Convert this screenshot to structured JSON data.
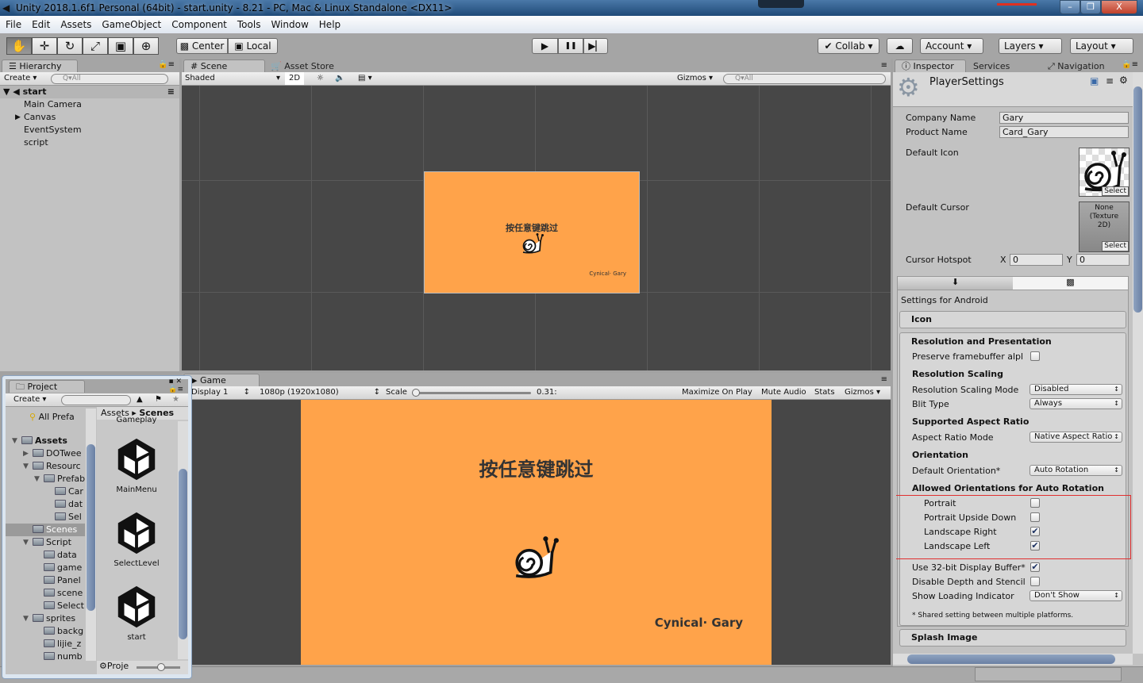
{
  "window": {
    "title": "Unity 2018.1.6f1 Personal (64bit) - start.unity - 8.21 - PC, Mac & Linux Standalone <DX11>",
    "min": "–",
    "max": "❐",
    "close": "X"
  },
  "menu": [
    "File",
    "Edit",
    "Assets",
    "GameObject",
    "Component",
    "Tools",
    "Window",
    "Help"
  ],
  "toolbar": {
    "tools": [
      "hand-tool",
      "move-tool",
      "rotate-tool",
      "scale-tool",
      "rect-tool",
      "transform-tool"
    ],
    "tool_glyphs": [
      "✋",
      "✛",
      "↻",
      "⤢",
      "▣",
      "⊕"
    ],
    "pivot": "Center",
    "space": "Local",
    "play": "▶",
    "pause": "❚❚",
    "step": "▶▏",
    "collab": "Collab ▾",
    "cloud": "☁",
    "account": "Account",
    "layers": "Layers",
    "layout": "Layout"
  },
  "hierarchy": {
    "tab": "Hierarchy",
    "create": "Create",
    "search": "Q▾All",
    "scene": "start",
    "items": [
      "Main Camera",
      "Canvas",
      "EventSystem",
      "script"
    ]
  },
  "scene": {
    "tab": "Scene",
    "tab2": "Asset Store",
    "shading": "Shaded",
    "mode2d": "2D",
    "gizmos": "Gizmos",
    "search": "Q▾All",
    "title_text": "按任意键跳过",
    "credit": "Cynical· Gary"
  },
  "game": {
    "tab": "Game",
    "display": "Display 1",
    "resolution": "1080p (1920x1080)",
    "scale_label": "Scale",
    "scale_value": "0.31:",
    "maximize": "Maximize On Play",
    "mute": "Mute Audio",
    "stats": "Stats",
    "gizmos": "Gizmos",
    "title_text": "按任意键跳过",
    "credit": "Cynical· Gary",
    "bg_color": "#FFA34A"
  },
  "project": {
    "tab": "Project",
    "create": "Create",
    "all_prefabs": "All Prefa",
    "breadcrumb_root": "Assets",
    "breadcrumb_current": "Scenes",
    "partial_item": "Gameplay",
    "footer": "Proje",
    "tree": [
      {
        "label": "Assets",
        "depth": 0,
        "bold": true,
        "arrow": "▼"
      },
      {
        "label": "DOTwee",
        "depth": 1,
        "arrow": "▶"
      },
      {
        "label": "Resourc",
        "depth": 1,
        "arrow": "▼"
      },
      {
        "label": "Prefab",
        "depth": 2,
        "arrow": "▼"
      },
      {
        "label": "Car",
        "depth": 3
      },
      {
        "label": "dat",
        "depth": 3
      },
      {
        "label": "Sel",
        "depth": 3
      },
      {
        "label": "Scenes",
        "depth": 1,
        "selected": true
      },
      {
        "label": "Script",
        "depth": 1,
        "arrow": "▼"
      },
      {
        "label": "data",
        "depth": 2
      },
      {
        "label": "game",
        "depth": 2
      },
      {
        "label": "Panel",
        "depth": 2
      },
      {
        "label": "scene",
        "depth": 2
      },
      {
        "label": "Select",
        "depth": 2
      },
      {
        "label": "sprites",
        "depth": 1,
        "arrow": "▼"
      },
      {
        "label": "backg",
        "depth": 2
      },
      {
        "label": "lijie_z",
        "depth": 2
      },
      {
        "label": "numb",
        "depth": 2
      }
    ],
    "scenes": [
      "MainMenu",
      "SelectLevel",
      "start"
    ]
  },
  "inspector": {
    "tab": "Inspector",
    "tab2": "Services",
    "tab3": "Navigation",
    "title": "PlayerSettings",
    "company_label": "Company Name",
    "company": "Gary",
    "product_label": "Product Name",
    "product": "Card_Gary",
    "icon_label": "Default Icon",
    "select": "Select",
    "cursor_label": "Default Cursor",
    "cursor_value": "None (Texture 2D)",
    "hotspot_label": "Cursor Hotspot",
    "x_label": "X",
    "x": "0",
    "y_label": "Y",
    "y": "0",
    "platform_title": "Settings for Android",
    "icon_section": "Icon",
    "res_section": "Resolution and Presentation",
    "preserve": "Preserve framebuffer alpl",
    "scaling_hdr": "Resolution Scaling",
    "scaling_mode": "Resolution Scaling Mode",
    "scaling_value": "Disabled",
    "blit": "Blit Type",
    "blit_value": "Always",
    "aspect_hdr": "Supported Aspect Ratio",
    "aspect_mode": "Aspect Ratio Mode",
    "aspect_value": "Native Aspect Ratio",
    "orient_hdr": "Orientation",
    "default_orient": "Default Orientation*",
    "orient_value": "Auto Rotation",
    "allowed_hdr": "Allowed Orientations for Auto Rotation",
    "orientations": [
      {
        "label": "Portrait",
        "checked": false
      },
      {
        "label": "Portrait Upside Down",
        "checked": false
      },
      {
        "label": "Landscape Right",
        "checked": true
      },
      {
        "label": "Landscape Left",
        "checked": true
      }
    ],
    "display32": "Use 32-bit Display Buffer*",
    "display32_checked": true,
    "depth": "Disable Depth and Stencil",
    "depth_checked": false,
    "loading": "Show Loading Indicator",
    "loading_value": "Don't Show",
    "note": "* Shared setting between multiple platforms.",
    "splash": "Splash Image",
    "highlight_color": "#E03030"
  }
}
